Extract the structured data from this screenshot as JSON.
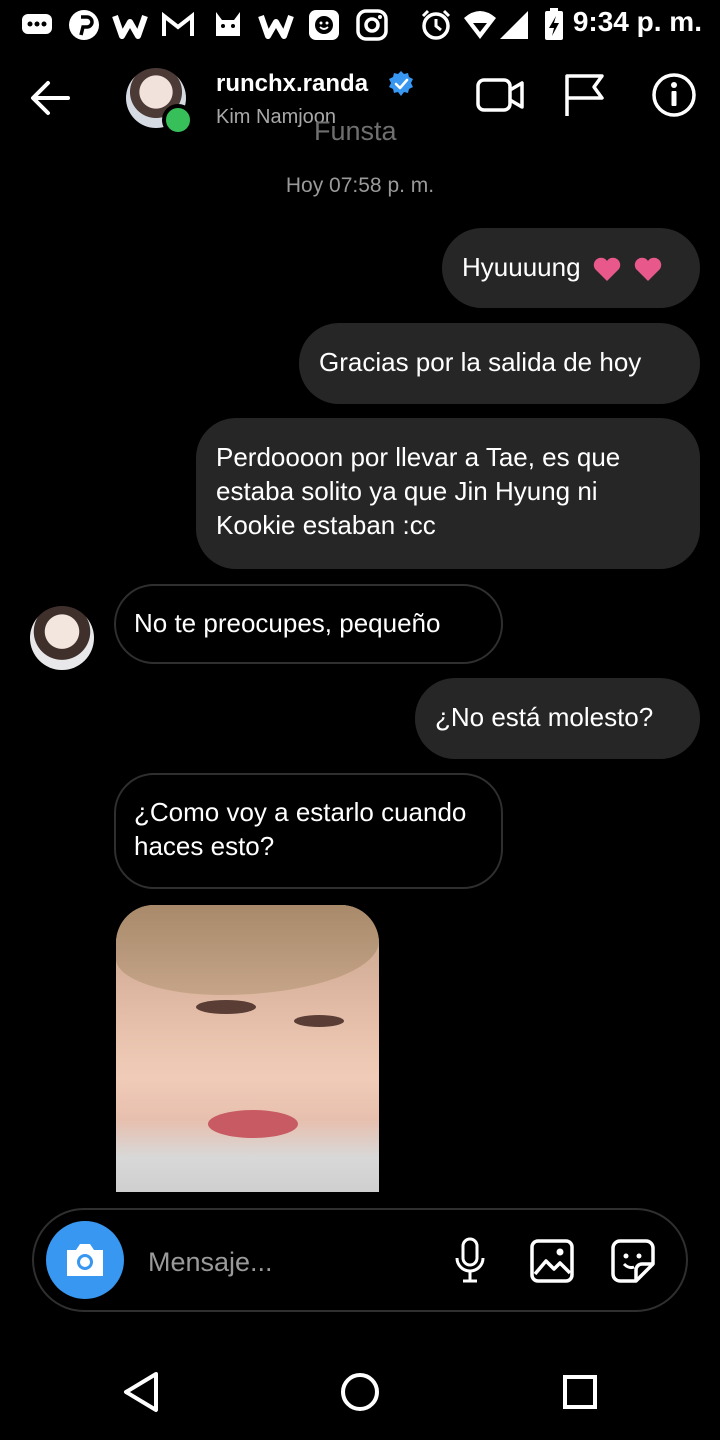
{
  "status_bar": {
    "time": "9:34 p. m.",
    "icons": [
      "chat-bubble-icon",
      "pinterest-icon",
      "wattpad-icon",
      "gmail-icon",
      "cat-icon",
      "wattpad-icon",
      "smiley-app-icon",
      "instagram-icon",
      "alarm-icon",
      "wifi-icon",
      "signal-icon",
      "battery-charging-icon"
    ]
  },
  "header": {
    "username": "runchx.randa",
    "full_name": "Kim Namjoon",
    "overlay_text": "Funsta",
    "verified": true,
    "online": true
  },
  "chat": {
    "timestamp": "Hoy 07:58 p. m.",
    "messages": [
      {
        "direction": "out",
        "text": "Hyuuuung"
      },
      {
        "direction": "out",
        "text": "Gracias por la salida de hoy"
      },
      {
        "direction": "out",
        "text": "Perdoooon por llevar a Tae, es que estaba solito ya que Jin Hyung ni Kookie estaban :cc"
      },
      {
        "direction": "in",
        "text": "No te preocupes, pequeño"
      },
      {
        "direction": "out",
        "text": "¿No está molesto?"
      },
      {
        "direction": "in",
        "text": "¿Como voy a estarlo cuando haces esto?"
      },
      {
        "direction": "in",
        "type": "photo"
      }
    ]
  },
  "composer": {
    "placeholder": "Mensaje..."
  },
  "colors": {
    "background": "#000000",
    "outgoing_bubble": "#262626",
    "camera_button": "#3897f0",
    "heart": "#e8588b",
    "verified": "#3897f0",
    "online": "#37c05a"
  }
}
